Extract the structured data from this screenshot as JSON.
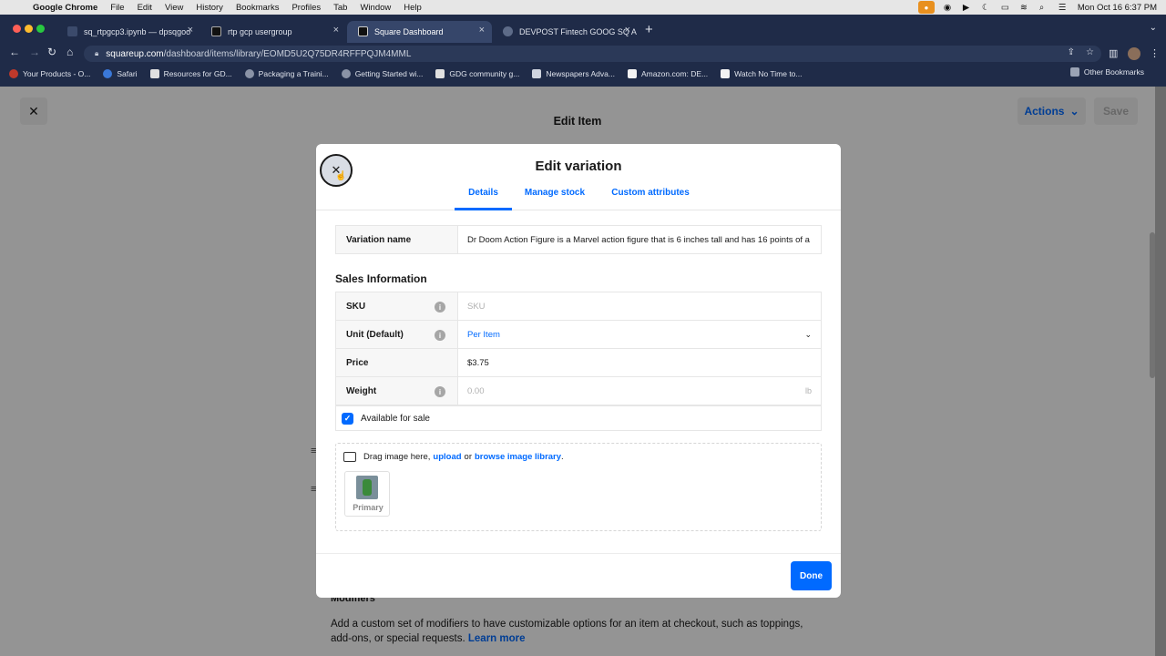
{
  "menubar": {
    "app": "Google Chrome",
    "items": [
      "File",
      "Edit",
      "View",
      "History",
      "Bookmarks",
      "Profiles",
      "Tab",
      "Window",
      "Help"
    ],
    "clock": "Mon Oct 16  6:37 PM"
  },
  "tabs": [
    {
      "title": "sq_rtpgcp3.ipynb — dpsqgoo",
      "active": false
    },
    {
      "title": "rtp gcp usergroup",
      "active": false
    },
    {
      "title": "Square Dashboard",
      "active": true
    },
    {
      "title": "DEVPOST Fintech GOOG SQ A",
      "active": false
    }
  ],
  "address": {
    "domain": "squareup.com",
    "path": "/dashboard/items/library/EOMD5U2Q75DR4RFFPQJM4MML"
  },
  "bookmarks": [
    "Your Products - O...",
    "Safari",
    "Resources for GD...",
    "Packaging a Traini...",
    "Getting Started wi...",
    "GDG community g...",
    "Newspapers Adva...",
    "Amazon.com: DE...",
    "Watch No Time to..."
  ],
  "bookmarks_other": "Other Bookmarks",
  "page": {
    "title": "Edit Item",
    "actions_label": "Actions",
    "save_label": "Save",
    "modifiers_title": "Modifiers",
    "modifiers_desc": "Add a custom set of modifiers to have customizable options for an item at checkout, such as toppings, add-ons, or special requests.",
    "learn_more": "Learn more"
  },
  "modal": {
    "title": "Edit variation",
    "tabs": [
      "Details",
      "Manage stock",
      "Custom attributes"
    ],
    "variation_label": "Variation name",
    "variation_value": "Dr Doom Action Figure is a Marvel action figure that is 6 inches tall and has 16 points of a",
    "sales_title": "Sales Information",
    "sku_label": "SKU",
    "sku_placeholder": "SKU",
    "unit_label": "Unit (Default)",
    "unit_value": "Per Item",
    "price_label": "Price",
    "price_value": "$3.75",
    "weight_label": "Weight",
    "weight_placeholder": "0.00",
    "weight_unit": "lb",
    "available_label": "Available for sale",
    "available_checked": true,
    "image_prefix": "Drag image here,",
    "image_upload": "upload",
    "image_or": "or",
    "image_browse": "browse image library",
    "image_suffix": ".",
    "thumb_label": "Primary",
    "done_label": "Done"
  },
  "colors": {
    "accent": "#006aff",
    "chrome_bg": "#1f2b48"
  }
}
